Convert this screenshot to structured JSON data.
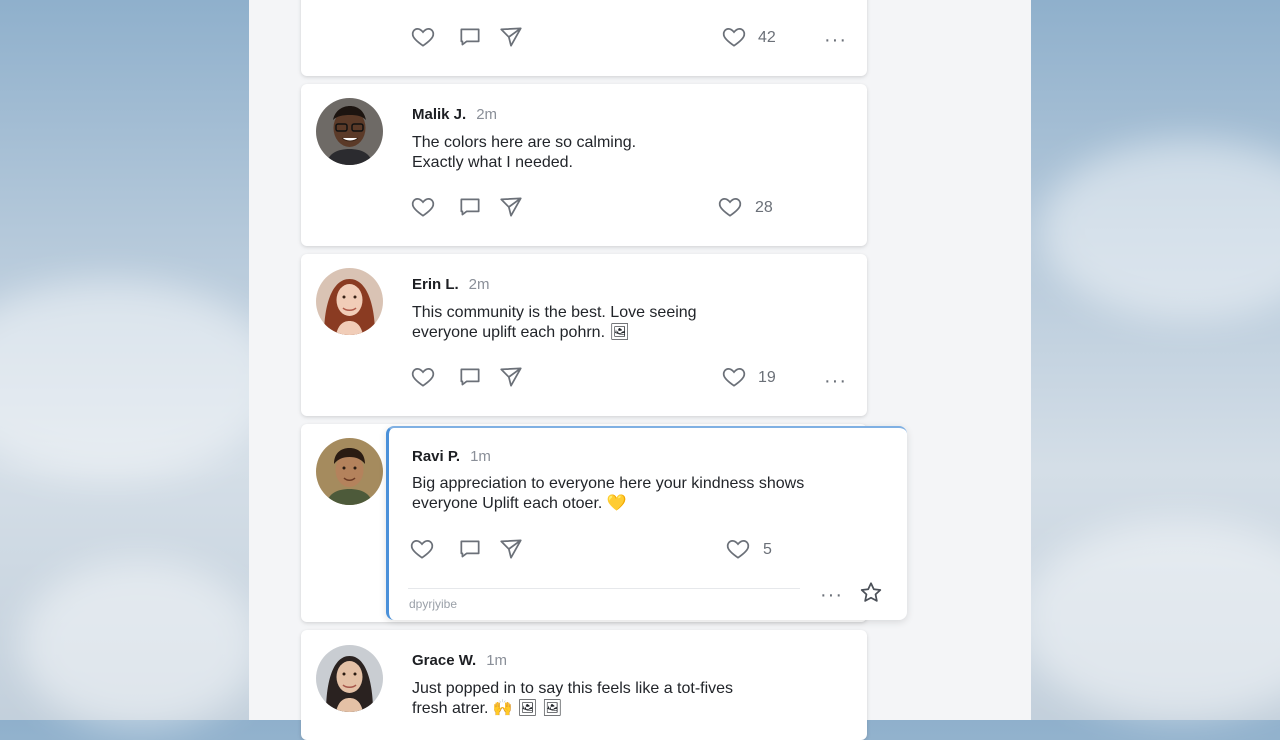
{
  "feed": {
    "top_post": {
      "likes": "42",
      "more": "···"
    },
    "posts": [
      {
        "name": "Malik J.",
        "time": "2m",
        "line1": "The colors here are so calming.",
        "line2": "Exactly what I needed.",
        "likes": "28"
      },
      {
        "name": "Erin L.",
        "time": "2m",
        "line1": "This community is the best. Love seeing",
        "line2": "everyone uplift each pohrn. 🖼",
        "likes": "19",
        "more": "···"
      },
      {
        "name": "Ravi P.",
        "time": "1m",
        "line1": "Big appreciation to everyone here your kindness shows",
        "line2": "everyone Uplift each otoer. 💛",
        "likes": "5",
        "more": "···",
        "footer": "dpyrjyibe"
      },
      {
        "name": "Grace W.",
        "time": "1m",
        "line1": "Just popped in to say this feels like a tot-fives",
        "line2": "fresh atrer. 🙌 🖼 🖼"
      }
    ]
  },
  "colors": {
    "accent": "#4a90d9",
    "card": "#ffffff",
    "panel": "#f4f5f7"
  },
  "icons": [
    "heart-icon",
    "comment-icon",
    "share-icon",
    "more-icon",
    "bookmark-star-icon"
  ]
}
